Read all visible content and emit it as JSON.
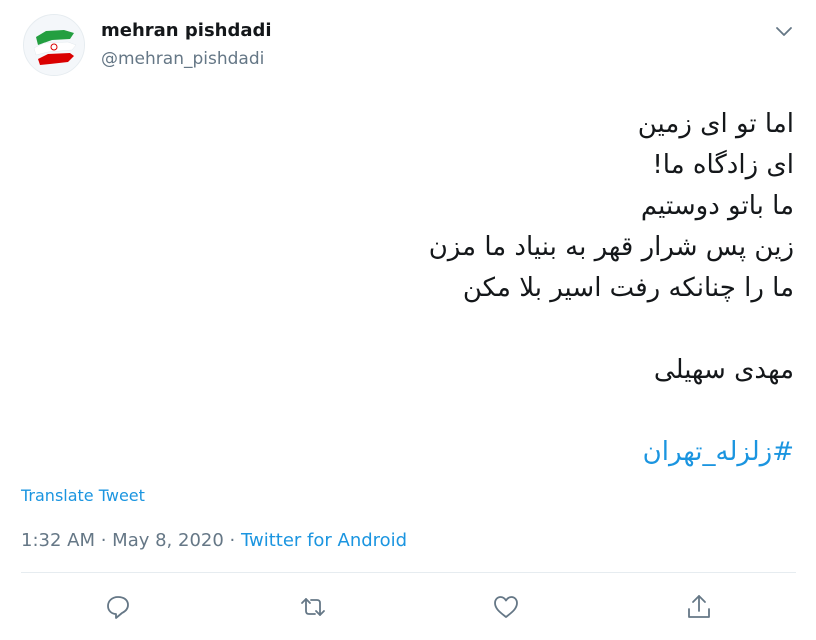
{
  "author": {
    "display_name": "mehran pishdadi",
    "handle": "@mehran_pishdadi",
    "avatar_icon": "iran-flag-avatar"
  },
  "tweet": {
    "lines": [
      "اما تو ای زمین",
      "ای زادگاه ما!",
      "ما باتو دوستیم",
      "زین پس شرار قهر به بنیاد ما مزن",
      "ما را چنانکه رفت اسیر بلا مکن"
    ],
    "signature": "مهدی سهیلی",
    "hashtag": "#زلزله_تهران"
  },
  "translate_label": "Translate Tweet",
  "meta": {
    "time": "1:32 AM",
    "separator1": " · ",
    "date": "May 8, 2020",
    "separator2": " · ",
    "source": "Twitter for Android"
  },
  "actions": [
    {
      "name": "reply",
      "icon": "reply-icon"
    },
    {
      "name": "retweet",
      "icon": "retweet-icon"
    },
    {
      "name": "like",
      "icon": "heart-icon"
    },
    {
      "name": "share",
      "icon": "share-icon"
    }
  ],
  "colors": {
    "text": "#14171a",
    "secondary": "#657786",
    "link": "#1b95e0",
    "divider": "#e6ecf0",
    "flag_green": "#239f40",
    "flag_red": "#da0000"
  }
}
